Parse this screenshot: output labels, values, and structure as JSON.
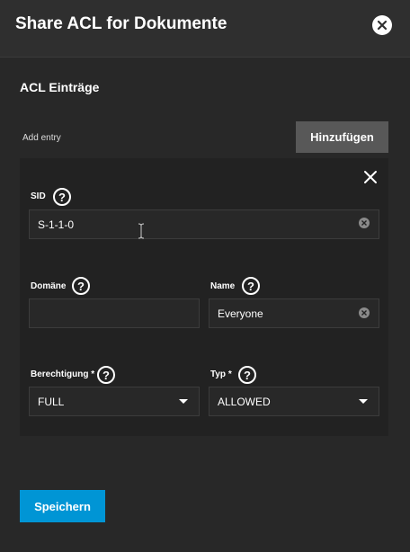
{
  "dialog": {
    "title": "Share ACL for Dokumente"
  },
  "section": {
    "title": "ACL Einträge",
    "add_label": "Add entry",
    "add_button": "Hinzufügen"
  },
  "entry": {
    "sid": {
      "label": "SID",
      "value": "S-1-1-0"
    },
    "domain": {
      "label": "Domäne",
      "value": ""
    },
    "name": {
      "label": "Name",
      "value": "Everyone"
    },
    "permission": {
      "label": "Berechtigung *",
      "value": "FULL"
    },
    "type": {
      "label": "Typ *",
      "value": "ALLOWED"
    },
    "help_glyph": "?"
  },
  "footer": {
    "save_button": "Speichern"
  },
  "colors": {
    "background": "#282828",
    "header": "#2f2f2f",
    "card": "#222222",
    "primary": "#0095d5",
    "secondary_button": "#585858"
  },
  "icons": {
    "dialog_close": "close-circle-icon",
    "entry_close": "close-icon",
    "help": "help-circle-icon",
    "clear": "clear-circle-icon",
    "dropdown": "caret-down-icon",
    "text_cursor": "i-beam-cursor-icon"
  }
}
